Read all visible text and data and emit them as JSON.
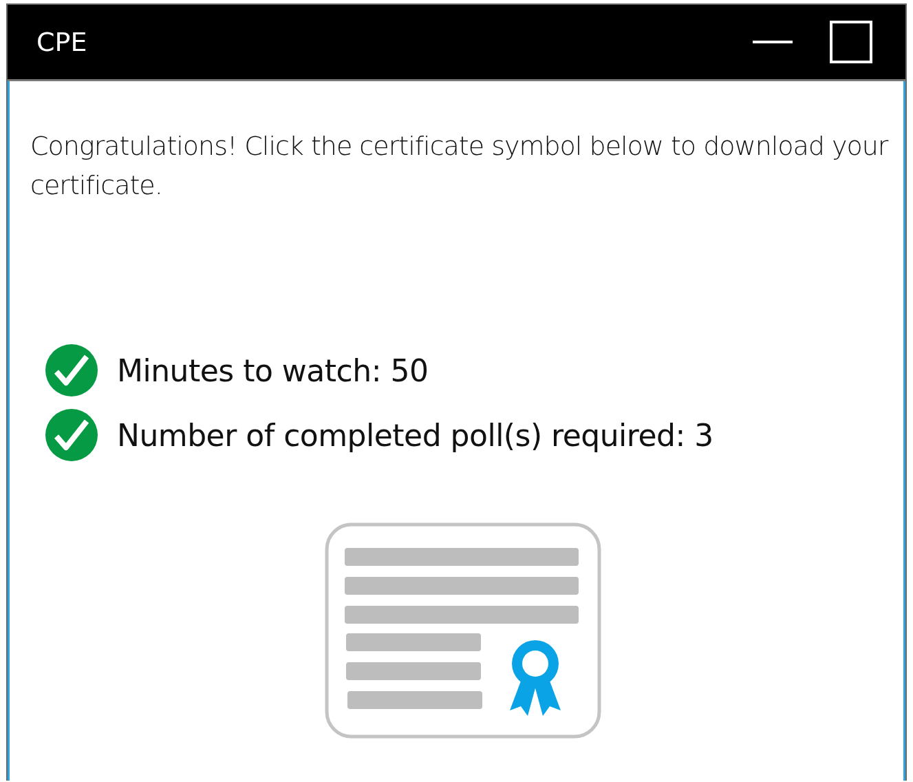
{
  "window": {
    "title": "CPE"
  },
  "message": "Congratulations!  Click the certificate symbol below to download your certificate.",
  "requirements": [
    {
      "label": "Minutes to watch: 50",
      "completed": true
    },
    {
      "label": "Number of completed poll(s) required: 3",
      "completed": true
    }
  ]
}
